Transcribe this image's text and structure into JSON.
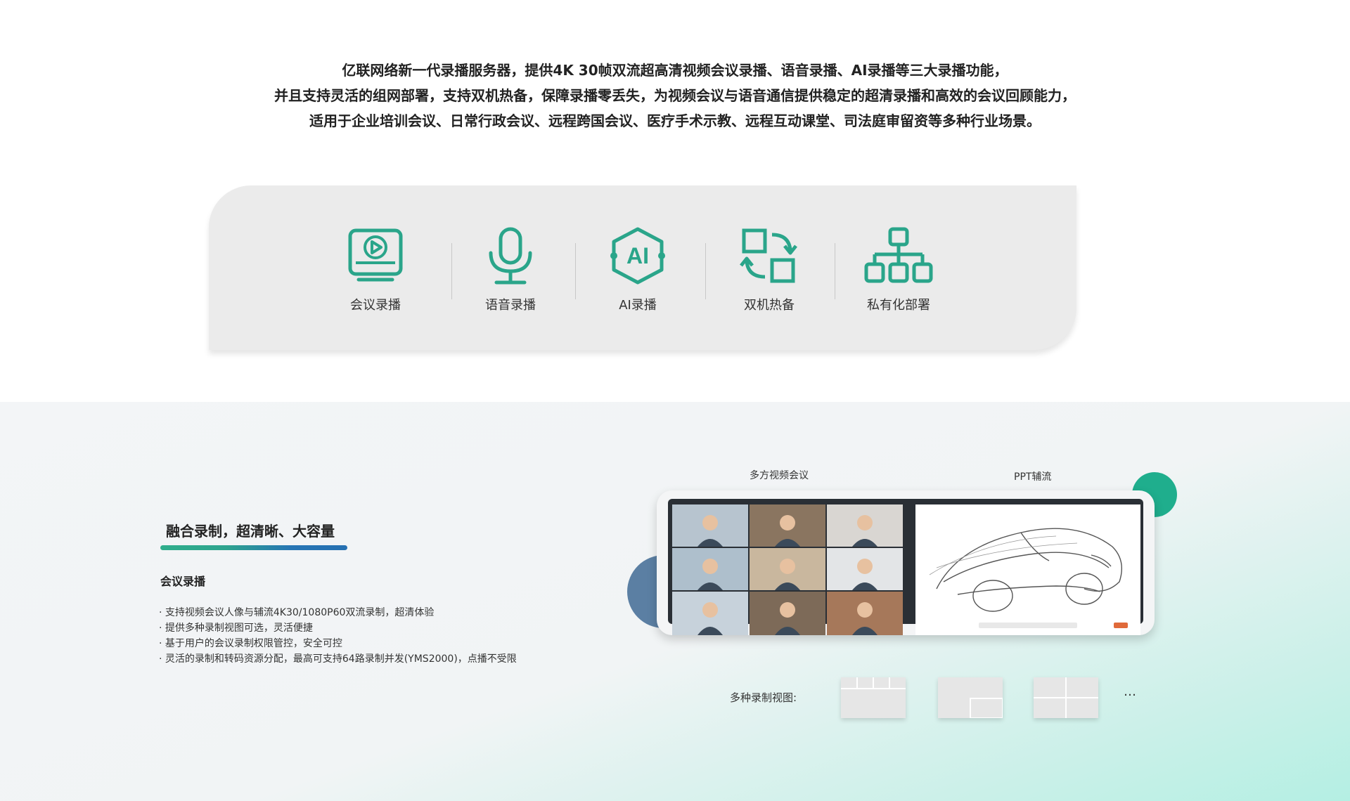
{
  "intro": {
    "lines": [
      "亿联网络新一代录播服务器，提供4K 30帧双流超高清视频会议录播、语音录播、AI录播等三大录播功能，",
      "并且支持灵活的组网部署，支持双机热备，保障录播零丢失，为视频会议与语音通信提供稳定的超清录播和高效的会议回顾能力，",
      "适用于企业培训会议、日常行政会议、远程跨国会议、医疗手术示教、远程互动课堂、司法庭审留资等多种行业场景。"
    ]
  },
  "features": [
    {
      "label": "会议录播",
      "icon": "video-play-icon"
    },
    {
      "label": "语音录播",
      "icon": "microphone-icon"
    },
    {
      "label": "AI录播",
      "icon": "ai-hexagon-icon"
    },
    {
      "label": "双机热备",
      "icon": "swap-backup-icon"
    },
    {
      "label": "私有化部署",
      "icon": "org-tree-icon"
    }
  ],
  "section": {
    "title": "融合录制，超清晰、大容量",
    "subtitle": "会议录播",
    "bullets": [
      "· 支持视频会议人像与辅流4K30/1080P60双流录制，超清体验",
      "· 提供多种录制视图可选，灵活便捷",
      "· 基于用户的会议录制权限管控，安全可控",
      "· 灵活的录制和转码资源分配，最高可支持64路录制并发(YMS2000)，点播不受限"
    ],
    "screen_labels": {
      "left": "多方视频会议",
      "right": "PPT辅流"
    },
    "views_label": "多种录制视图:",
    "ellipsis": "…"
  },
  "colors": {
    "accent_green": "#2aa58a",
    "accent_blue": "#2670b2",
    "panel_bg": "#ebebeb"
  }
}
